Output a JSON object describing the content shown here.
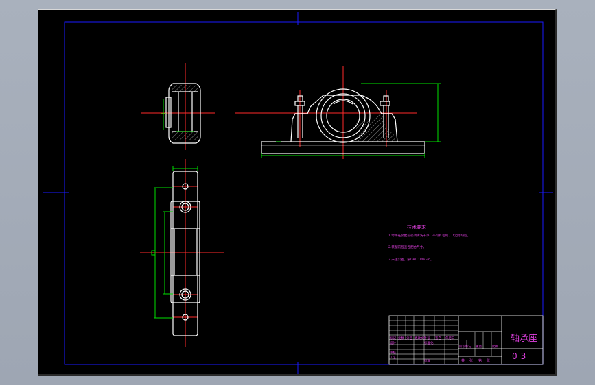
{
  "colors": {
    "background": "#000000",
    "border": "#1a1aff",
    "centerline": "#ff2a2a",
    "outline": "#ffffff",
    "dimension": "#00e000",
    "hatch": "#8a8a8a",
    "text": "#e040e0"
  },
  "notes": {
    "heading": "技术要求",
    "lines": [
      "1.零件在装配前必须清洗干净，不得有毛刺、飞边等缺陷。",
      "2.装配前检查各配合尺寸。",
      "3.未注公差，按GB/T1804-m。"
    ]
  },
  "title_block": {
    "drawing_name": "轴承座",
    "drawing_number": "03",
    "cells": [
      "标记",
      "处数",
      "分区",
      "更改文件号",
      "签名",
      "年月日",
      "设计",
      "标准化",
      "阶段标记",
      "重量",
      "比例",
      "审核",
      "工艺",
      "批准",
      "共",
      "张",
      "第",
      "张"
    ]
  }
}
